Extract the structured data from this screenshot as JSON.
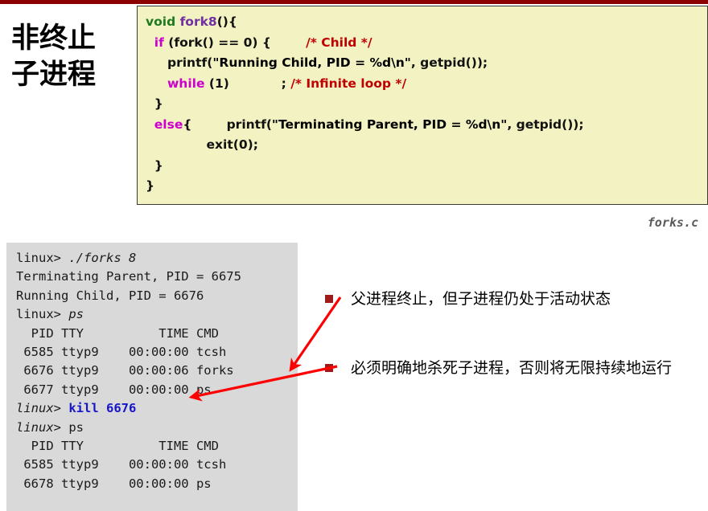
{
  "slide": {
    "title_lines": [
      "非终止",
      "子进程"
    ],
    "accent_color": "#8B0000"
  },
  "code_panel": {
    "background": "#F2F2C2",
    "file_caption": "forks.c",
    "colors": {
      "type": "#1F7A1F",
      "function": "#7030A0",
      "keyword": "#CC00CC",
      "comment": "#C00000",
      "string": "#A0246E",
      "plain": "#111111"
    },
    "lines": [
      {
        "tokens": [
          {
            "t": "void ",
            "c": "kw-type"
          },
          {
            "t": "fork8",
            "c": "fn-name"
          },
          {
            "t": "(){",
            "c": "plain"
          }
        ]
      },
      {
        "tokens": [
          {
            "t": "  ",
            "c": "plain"
          },
          {
            "t": "if",
            "c": "kw-ctrl"
          },
          {
            "t": " (fork() == 0) {        ",
            "c": "plain"
          },
          {
            "t": "/* Child */",
            "c": "comment"
          }
        ]
      },
      {
        "tokens": [
          {
            "t": "     printf(",
            "c": "plain"
          },
          {
            "t": "\"Running Child, PID = %d\\n\"",
            "c": "str"
          },
          {
            "t": ", getpid());",
            "c": "plain"
          }
        ]
      },
      {
        "tokens": [
          {
            "t": "     ",
            "c": "plain"
          },
          {
            "t": "while",
            "c": "kw-ctrl"
          },
          {
            "t": " (1)            ; ",
            "c": "plain"
          },
          {
            "t": "/* Infinite loop */",
            "c": "comment"
          }
        ]
      },
      {
        "tokens": [
          {
            "t": "  }",
            "c": "plain"
          }
        ]
      },
      {
        "tokens": [
          {
            "t": "  ",
            "c": "plain"
          },
          {
            "t": "else",
            "c": "kw-ctrl"
          },
          {
            "t": "{        printf(",
            "c": "plain"
          },
          {
            "t": "\"Terminating Parent, PID = %d\\n\"",
            "c": "str"
          },
          {
            "t": ", getpid());",
            "c": "plain"
          }
        ]
      },
      {
        "tokens": [
          {
            "t": "              exit(0);",
            "c": "plain"
          }
        ]
      },
      {
        "tokens": [
          {
            "t": "  }",
            "c": "plain"
          }
        ]
      },
      {
        "tokens": [
          {
            "t": "}",
            "c": "plain"
          }
        ]
      }
    ]
  },
  "terminal": {
    "background": "#D9D9D9",
    "kill_color": "#1616C8",
    "lines": [
      {
        "spans": [
          {
            "t": "linux> ",
            "c": ""
          },
          {
            "t": "./forks 8",
            "c": "term-em"
          }
        ]
      },
      {
        "spans": [
          {
            "t": "Terminating Parent, PID = 6675",
            "c": ""
          }
        ]
      },
      {
        "spans": [
          {
            "t": "Running Child, PID = 6676",
            "c": ""
          }
        ]
      },
      {
        "spans": [
          {
            "t": "linux> ",
            "c": ""
          },
          {
            "t": "ps",
            "c": "term-em"
          }
        ]
      },
      {
        "spans": [
          {
            "t": "  PID TTY          TIME CMD",
            "c": ""
          }
        ]
      },
      {
        "spans": [
          {
            "t": " 6585 ttyp9    00:00:00 tcsh",
            "c": ""
          }
        ]
      },
      {
        "spans": [
          {
            "t": " 6676 ttyp9    00:00:06 forks",
            "c": ""
          }
        ]
      },
      {
        "spans": [
          {
            "t": " 6677 ttyp9    00:00:00 ps",
            "c": ""
          }
        ]
      },
      {
        "spans": [
          {
            "t": "linux> ",
            "c": "term-em"
          },
          {
            "t": "kill 6676",
            "c": "term-kill"
          }
        ]
      },
      {
        "spans": [
          {
            "t": "linux> ",
            "c": "term-em"
          },
          {
            "t": "ps",
            "c": ""
          }
        ]
      },
      {
        "spans": [
          {
            "t": "  PID TTY          TIME CMD",
            "c": ""
          }
        ]
      },
      {
        "spans": [
          {
            "t": " 6585 ttyp9    00:00:00 tcsh",
            "c": ""
          }
        ]
      },
      {
        "spans": [
          {
            "t": " 6678 ttyp9    00:00:00 ps",
            "c": ""
          }
        ]
      }
    ]
  },
  "annotations": [
    {
      "bullet_color": "#9E1B1B",
      "text": "父进程终止，但子进程仍处于活动状态"
    },
    {
      "bullet_color": "#9E1B1B",
      "text": "必须明确地杀死子进程，否则将无限持续地运行"
    }
  ],
  "arrows": {
    "color": "#FF0000"
  }
}
